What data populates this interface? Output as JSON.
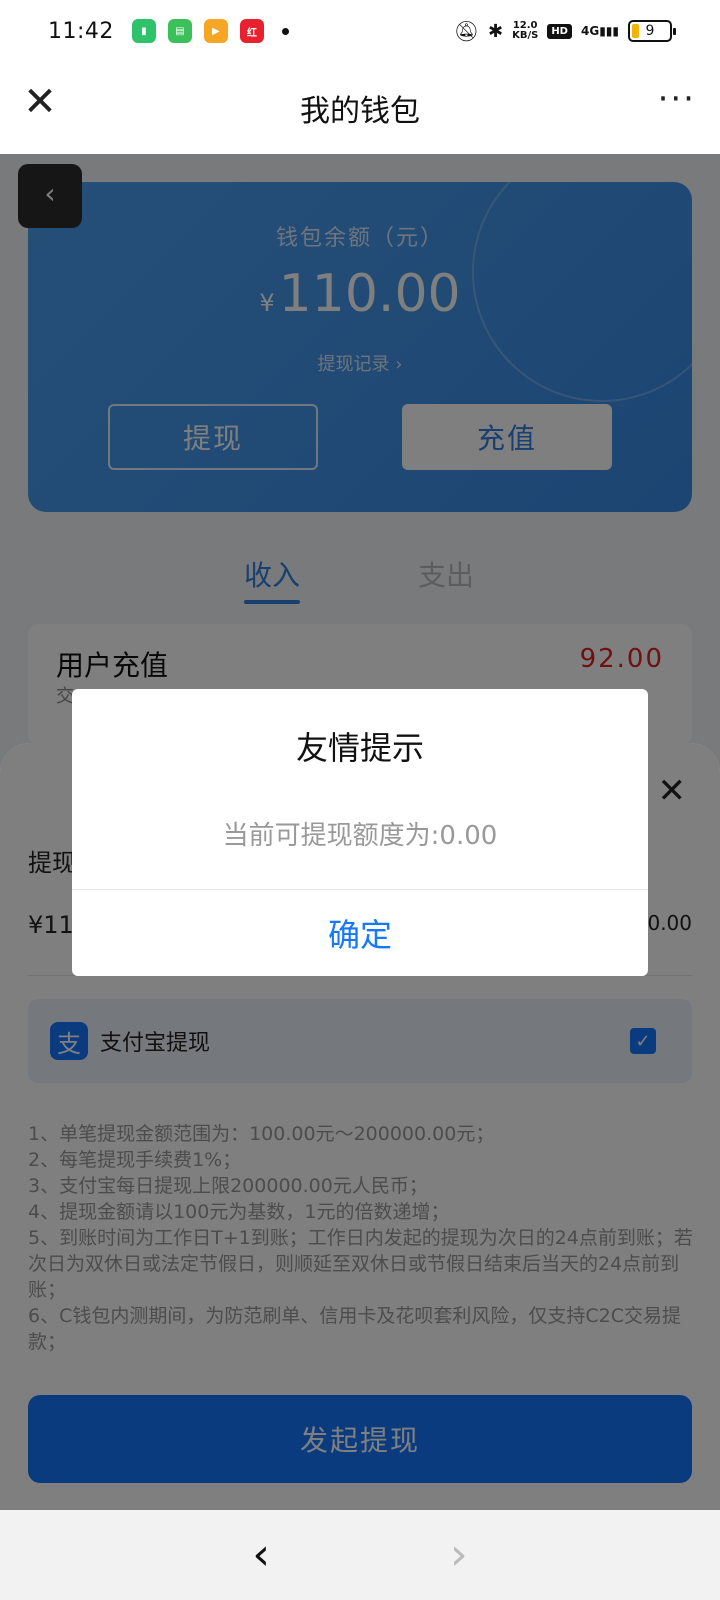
{
  "status_bar": {
    "time": "11:42",
    "speed": "12.0",
    "speed_unit": "KB/S",
    "hd": "HD",
    "network": "4G",
    "battery": "9"
  },
  "nav": {
    "title": "我的钱包",
    "close_icon": "close-icon",
    "more_icon": "more-icon",
    "more_glyph": "···"
  },
  "wallet": {
    "balance_label": "钱包余额（元）",
    "currency": "¥",
    "balance": "110.00",
    "record_link": "提现记录 ›",
    "withdraw_label": "提现",
    "recharge_label": "充值"
  },
  "tabs": {
    "income": "收入",
    "expense": "支出"
  },
  "records": [
    {
      "title": "用户充值",
      "subtitle": "交",
      "amount": "92.00"
    }
  ],
  "sheet": {
    "amount_label": "提现",
    "amount_value": "¥11",
    "amount_right": "0.00",
    "method_label": "支付宝提现",
    "rules": [
      "1、单笔提现金额范围为：100.00元～200000.00元；",
      "2、每笔提现手续费1%；",
      "3、支付宝每日提现上限200000.00元人民币；",
      "4、提现金额请以100元为基数，1元的倍数递增；",
      "5、到账时间为工作日T+1到账；工作日内发起的提现为次日的24点前到账；若次日为双休日或法定节假日，则顺延至双休日或节假日结束后当天的24点前到账；",
      "6、C钱包内测期间，为防范刷单、信用卡及花呗套利风险，仅支持C2C交易提款；"
    ],
    "submit_label": "发起提现"
  },
  "dialog": {
    "title": "友情提示",
    "message": "当前可提现额度为:0.00",
    "confirm": "确定"
  },
  "colors": {
    "accent": "#1677ff",
    "amount_red": "#e02020",
    "card_blue": "#4b9ff0"
  }
}
